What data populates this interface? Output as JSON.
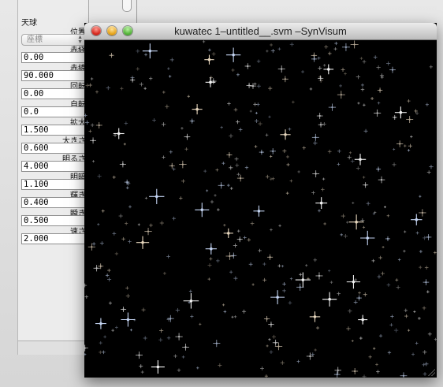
{
  "window": {
    "title": "kuwatec 1–untitled__.svm –SynVisum",
    "buttons": {
      "close": "close-button",
      "minimize": "minimize-button",
      "zoom": "zoom-button"
    }
  },
  "panel": {
    "section": "天球",
    "fields": [
      {
        "label": "位置",
        "type": "select",
        "value": "座標"
      },
      {
        "label": "赤経",
        "type": "text",
        "value": "0.00"
      },
      {
        "label": "赤緯",
        "type": "text",
        "value": "90.000"
      },
      {
        "label": "回転",
        "type": "text",
        "value": "0.00"
      },
      {
        "label": "自転",
        "type": "text",
        "value": "0.0"
      },
      {
        "label": "拡大",
        "type": "text",
        "value": "1.500"
      },
      {
        "label": "大きさ",
        "type": "text",
        "value": "0.600"
      },
      {
        "label": "明るさ",
        "type": "text",
        "value": "4.000"
      },
      {
        "label": "明暗",
        "type": "text",
        "value": "1.100"
      },
      {
        "label": "輝き",
        "type": "text",
        "value": "0.400"
      },
      {
        "label": "瞬き",
        "type": "text",
        "value": "0.500"
      },
      {
        "label": "速さ",
        "type": "text",
        "value": "2.000"
      }
    ]
  },
  "colors": {
    "star_white": "#ffffff",
    "star_warm": "#f3e2c8",
    "star_cool": "#cfe0ff",
    "background": "#000000"
  }
}
